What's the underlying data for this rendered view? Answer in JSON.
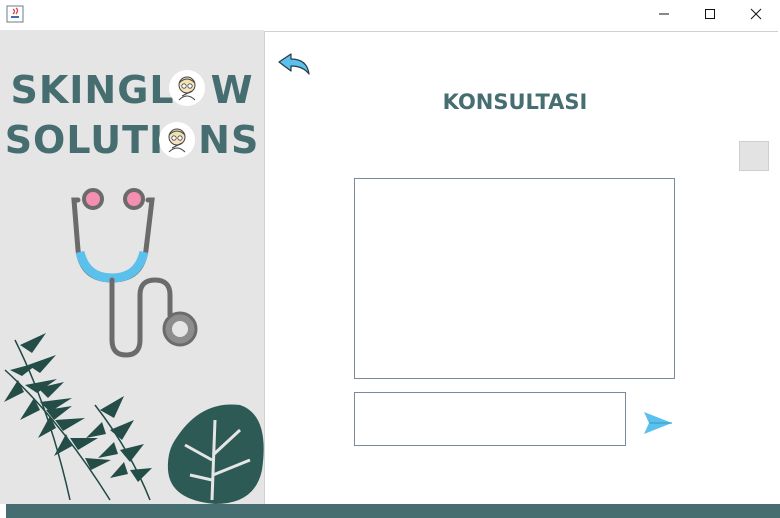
{
  "window": {
    "controls": [
      "minimize",
      "maximize",
      "close"
    ]
  },
  "brand": {
    "line1_prefix": "SKINGL",
    "line1_suffix": "W",
    "line2_prefix": "SOLUTI",
    "line2_suffix": "NS",
    "icons": [
      "face-avatar-icon",
      "face-avatar-icon",
      "stethoscope-icon",
      "tropical-leaves"
    ]
  },
  "header": {
    "title": "KONSULTASI",
    "back_icon": "back-arrow-icon"
  },
  "chat": {
    "messages_text": "",
    "input_value": "",
    "send_icon": "send-icon"
  },
  "colors": {
    "brand_teal": "#466e71",
    "left_panel_bg": "#e5e5e5",
    "accent_blue": "#5bc0eb",
    "stethoscope_pink": "#f48fb1",
    "leaf_dark": "#1f4a45"
  }
}
